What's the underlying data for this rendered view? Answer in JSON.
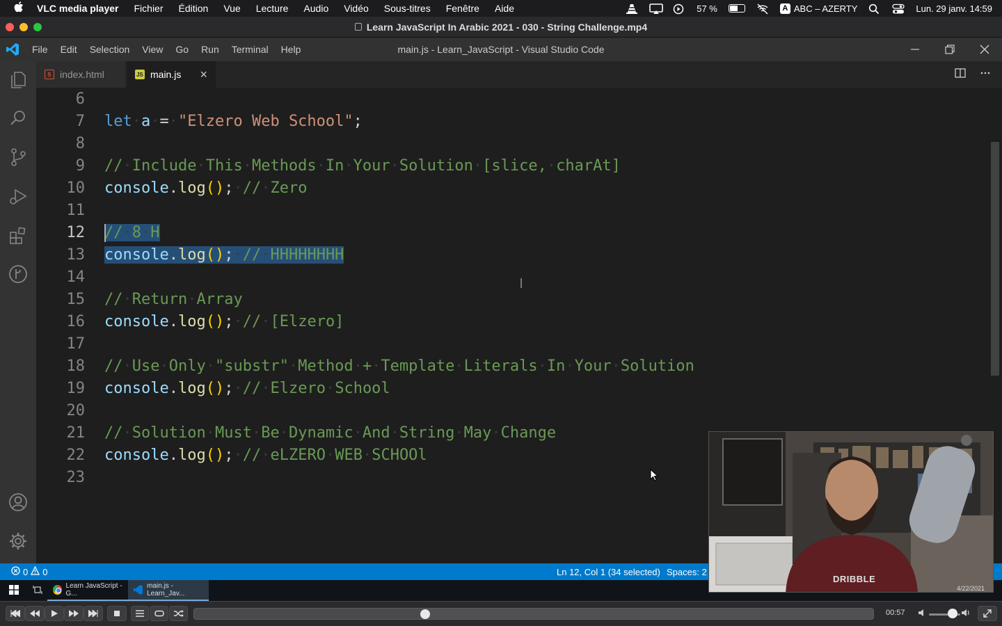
{
  "macos": {
    "app_name": "VLC media player",
    "menus": [
      "Fichier",
      "Édition",
      "Vue",
      "Lecture",
      "Audio",
      "Vidéo",
      "Sous-titres",
      "Fenêtre",
      "Aide"
    ],
    "battery_percent": "57 %",
    "battery_level": 0.57,
    "keyboard_badge": "A",
    "keyboard_layout": "ABC – AZERTY",
    "datetime": "Lun. 29 janv.  14:59"
  },
  "vlc": {
    "window_title": "Learn JavaScript In Arabic 2021 - 030 - String Challenge.mp4",
    "elapsed": "00:57",
    "progress": 0.34,
    "volume": 0.75
  },
  "vscode": {
    "menus": [
      "File",
      "Edit",
      "Selection",
      "View",
      "Go",
      "Run",
      "Terminal",
      "Help"
    ],
    "window_title": "main.js - Learn_JavaScript - Visual Studio Code",
    "tabs": [
      {
        "label": "index.html"
      },
      {
        "label": "main.js"
      }
    ],
    "file_badges": {
      "html": "5",
      "js": "JS"
    },
    "lines": {
      "n6": "6",
      "n7": "7",
      "n8": "8",
      "n9": "9",
      "n10": "10",
      "n11": "11",
      "n12": "12",
      "n13": "13",
      "n14": "14",
      "n15": "15",
      "n16": "16",
      "n17": "17",
      "n18": "18",
      "n19": "19",
      "n20": "20",
      "n21": "21",
      "n22": "22",
      "n23": "23"
    },
    "code": {
      "l7_kw": "let",
      "l7_var": "a",
      "l7_op": "=",
      "l7_str": "\"Elzero Web School\"",
      "l7_end": ";",
      "l9_cmt": "// Include This Methods In Your Solution [slice, charAt]",
      "l10_cmt": "// Zero",
      "l12_cmt": "// 8 H",
      "l13_cmt": "// HHHHHHHH",
      "l15_cmt": "// Return Array",
      "l16_cmt": "// [Elzero]",
      "l18_cmt": "// Use Only \"substr\" Method + Template Literals In Your Solution",
      "l19_cmt": "// Elzero School",
      "l21_cmt": "// Solution Must Be Dynamic And String May Change",
      "l22_cmt": "// eLZERO WEB SCHOOl",
      "console": "console",
      "dot": ".",
      "log": "log",
      "parens": "()",
      "semi": ";"
    },
    "status": {
      "errors": "0",
      "warnings": "0",
      "position": "Ln 12, Col 1 (34 selected)",
      "spaces": "Spaces: 2"
    }
  },
  "taskbar": {
    "apps": [
      {
        "label": "Learn JavaScript - G..."
      },
      {
        "label": "main.js - Learn_Jav..."
      }
    ]
  },
  "webcam": {
    "shirt_text": "DRIBBLE",
    "date": "4/22/2021"
  }
}
